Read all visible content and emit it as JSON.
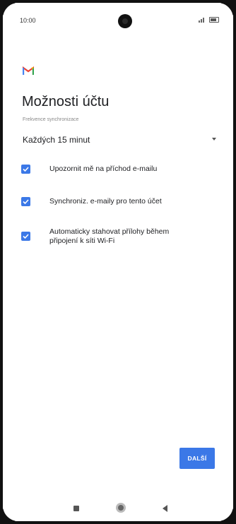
{
  "status_bar": {
    "time": "10:00"
  },
  "app": {
    "logo_icon": "gmail-icon",
    "brand_colors": [
      "#EA4335",
      "#4285F4",
      "#34A853",
      "#FBBC05"
    ]
  },
  "page": {
    "title": "Možnosti účtu"
  },
  "sync": {
    "label": "Frekvence synchronizace",
    "value": "Každých 15 minut"
  },
  "options": [
    {
      "label": "Upozornit mě na příchod e-mailu",
      "checked": true
    },
    {
      "label": "Synchroniz. e-maily pro tento účet",
      "checked": true
    },
    {
      "label": "Automaticky stahovat přílohy během připojení k síti Wi-Fi",
      "checked": true
    }
  ],
  "actions": {
    "next_label": "DALŠÍ"
  },
  "colors": {
    "accent": "#3b78e7"
  },
  "nav": {
    "recents_icon": "square-icon",
    "home_icon": "circle-icon",
    "back_icon": "triangle-back-icon"
  }
}
